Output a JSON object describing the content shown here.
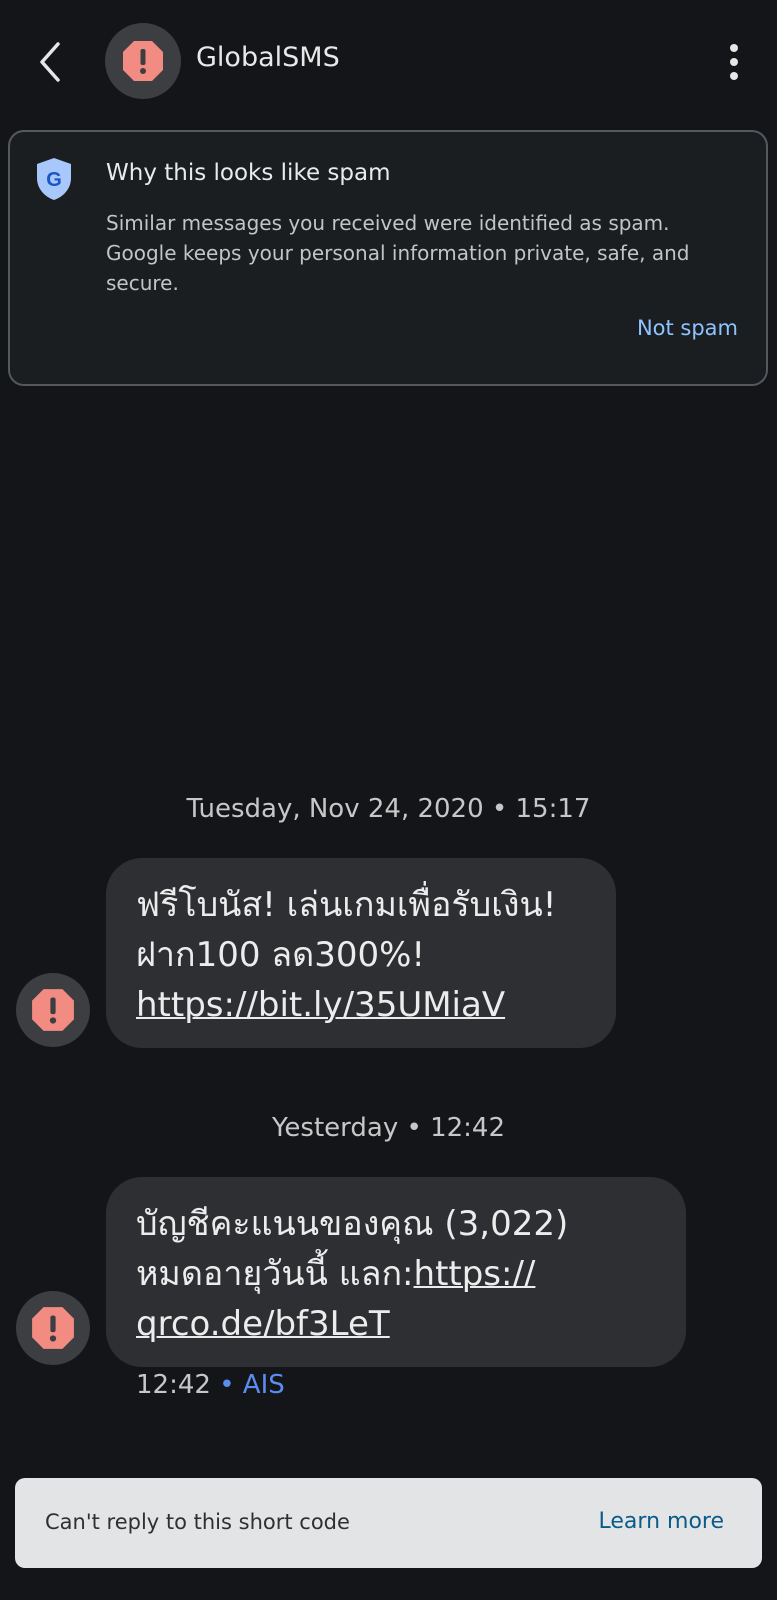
{
  "header": {
    "contact_name": "GlobalSMS",
    "back_icon": "back-arrow-icon",
    "menu_icon": "more-vert-icon"
  },
  "spam_card": {
    "title": "Why this looks like spam",
    "description": "Similar messages you received were identified as spam. Google keeps your personal information private, safe, and secure.",
    "action_label": "Not spam",
    "icon": "google-shield-icon"
  },
  "messages": [
    {
      "date_label": "Tuesday, Nov 24, 2020 • 15:17",
      "line1": "ฟรีโบนัส! เล่นเกมเพื่อรับเงิน!",
      "line2": "ฝาก100 ลด300%!",
      "link": "https://bit.ly/35UMiaV"
    },
    {
      "date_label": "Yesterday • 12:42",
      "line1": "บัญชีคะแนนของคุณ (3,022)",
      "line2_prefix": "หมดอายุวันนี้ แลก:",
      "link_part1": "https://",
      "link_part2": "qrco.de/bf3LeT",
      "time": "12:42",
      "carrier": "• AIS"
    }
  ],
  "reply_bar": {
    "text": "Can't reply to this short code",
    "action_label": "Learn more"
  },
  "colors": {
    "background": "#131518",
    "bubble": "#2d2f32",
    "spam_alert": "#f28b82",
    "link_blue": "#8ec3ff",
    "carrier_blue": "#5b8def"
  }
}
